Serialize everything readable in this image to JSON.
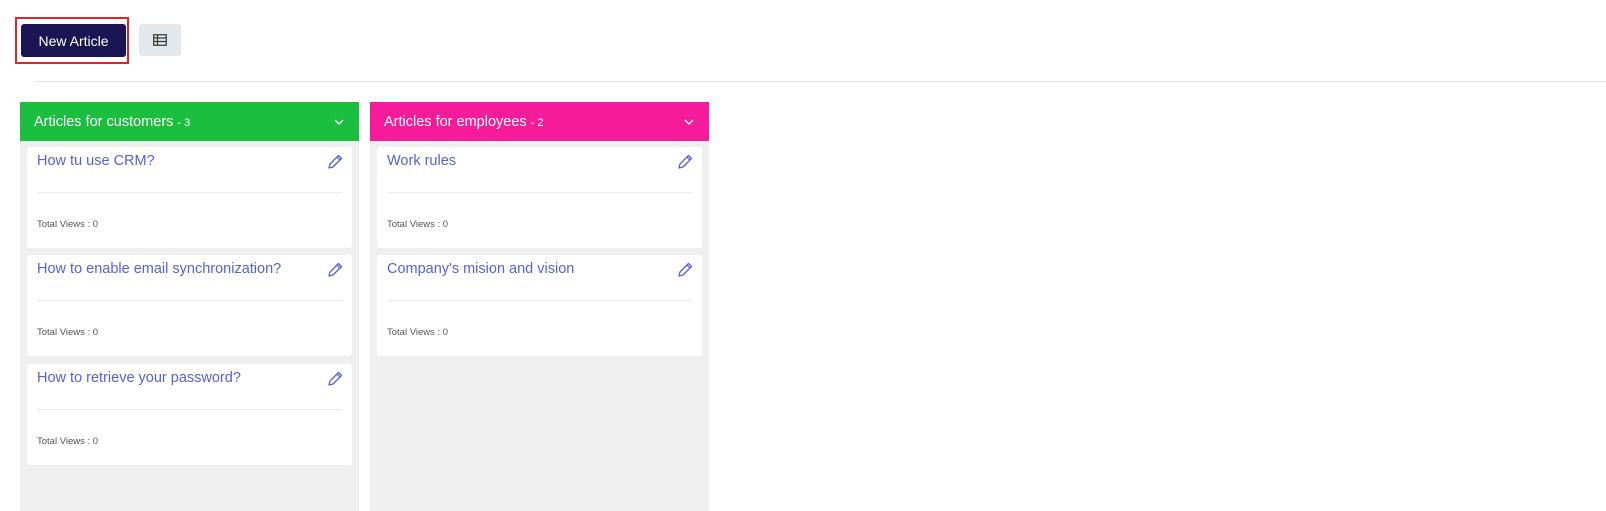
{
  "toolbar": {
    "new_article_label": "New Article",
    "view_toggle_icon": "table-icon"
  },
  "colors": {
    "primary_button": "#1c1553",
    "customers_column": "#1bbf3f",
    "employees_column": "#f51b9a",
    "link": "#5561e0"
  },
  "columns": [
    {
      "title": "Articles for customers",
      "count": "- 3",
      "color": "#1bbf3f",
      "articles": [
        {
          "title": "How tu use CRM?",
          "views_label": "Total Views : 0"
        },
        {
          "title": "How to enable email synchronization?",
          "views_label": "Total Views : 0"
        },
        {
          "title": "How to retrieve your password?",
          "views_label": "Total Views : 0"
        }
      ]
    },
    {
      "title": "Articles for employees",
      "count": "- 2",
      "color": "#f51b9a",
      "articles": [
        {
          "title": "Work rules",
          "views_label": "Total Views : 0"
        },
        {
          "title": "Company's mision and vision",
          "views_label": "Total Views : 0"
        }
      ]
    }
  ]
}
